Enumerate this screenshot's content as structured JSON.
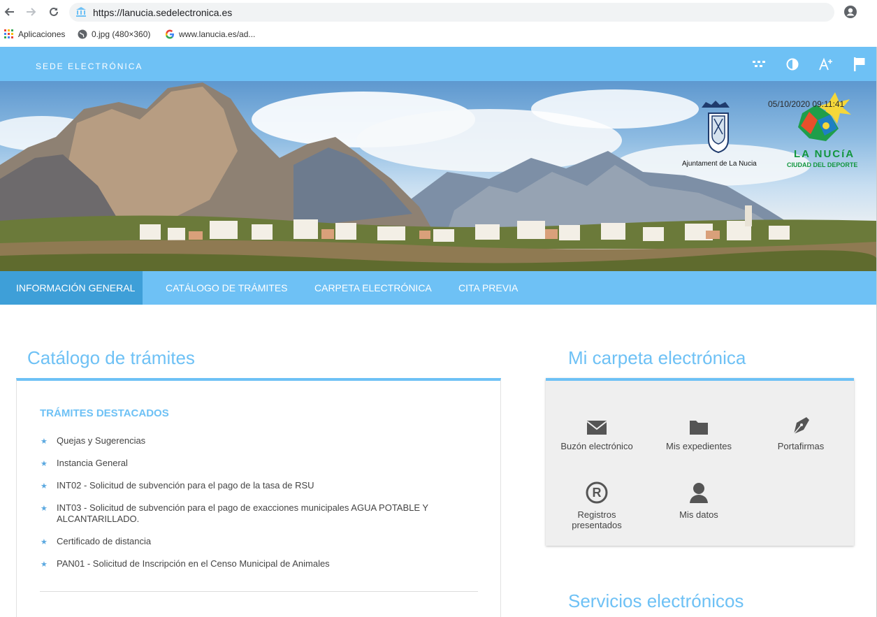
{
  "browser": {
    "url": "https://lanucia.sedelectronica.es",
    "bookmarks": [
      "Aplicaciones",
      "0.jpg (480×360)",
      "www.lanucia.es/ad..."
    ]
  },
  "site": {
    "title": "SEDE ELECTRÓNICA",
    "tools": [
      "apps-grid-icon",
      "contrast-icon",
      "font-size-icon",
      "language-flag-icon"
    ]
  },
  "banner": {
    "datetime": "05/10/2020 09:11:41",
    "coat_caption": "Ajuntament de La Nucia",
    "logo_title": "LA NUCíA",
    "logo_subtitle": "CIUDAD DEL DEPORTE"
  },
  "nav": {
    "items": [
      {
        "label": "INFORMACIÓN GENERAL",
        "active": true
      },
      {
        "label": "CATÁLOGO DE TRÁMITES",
        "active": false
      },
      {
        "label": "CARPETA ELECTRÓNICA",
        "active": false
      },
      {
        "label": "CITA PREVIA",
        "active": false
      }
    ]
  },
  "catalog": {
    "heading": "Catálogo de trámites",
    "featured_title": "TRÁMITES DESTACADOS",
    "items": [
      "Quejas y Sugerencias",
      "Instancia General",
      "INT02 - Solicitud de subvención para el pago de la tasa de RSU",
      "INT03 - Solicitud de subvención para el pago de exacciones municipales AGUA POTABLE Y ALCANTARILLADO.",
      "Certificado de distancia",
      "PAN01 - Solicitud de Inscripción en el Censo Municipal de Animales"
    ]
  },
  "folder": {
    "heading": "Mi carpeta electrónica",
    "tiles": [
      {
        "label": "Buzón electrónico",
        "icon": "mail-icon"
      },
      {
        "label": "Mis expedientes",
        "icon": "folder-icon"
      },
      {
        "label": "Portafirmas",
        "icon": "pen-icon"
      },
      {
        "label": "Registros presentados",
        "icon": "registered-icon"
      },
      {
        "label": "Mis datos",
        "icon": "user-icon"
      }
    ]
  },
  "services": {
    "heading": "Servicios electrónicos"
  },
  "colors": {
    "accent": "#6ec1f5",
    "nav_active": "#3e9fd8",
    "logo_green": "#12963e"
  }
}
